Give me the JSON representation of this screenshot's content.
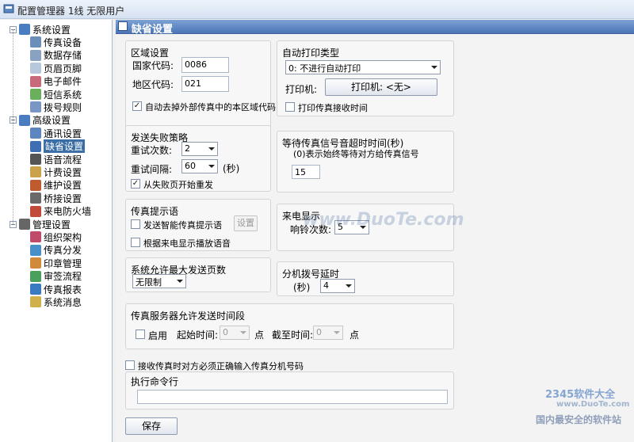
{
  "window": {
    "title": "配置管理器 1线 无限用户"
  },
  "tree": [
    {
      "label": "系统设置",
      "level": 0,
      "color": "#4a7cc0"
    },
    {
      "label": "传真设备",
      "level": 1,
      "color": "#6a8fb8"
    },
    {
      "label": "数据存储",
      "level": 1,
      "color": "#8aa2c2"
    },
    {
      "label": "页眉页脚",
      "level": 1,
      "color": "#b7c7dc"
    },
    {
      "label": "电子邮件",
      "level": 1,
      "color": "#c96a7a"
    },
    {
      "label": "短信系统",
      "level": 1,
      "color": "#6aaf5c"
    },
    {
      "label": "拨号规则",
      "level": 1,
      "color": "#7a96c4"
    },
    {
      "label": "高级设置",
      "level": 0,
      "color": "#4a7cc0"
    },
    {
      "label": "通讯设置",
      "level": 1,
      "color": "#5d86be"
    },
    {
      "label": "缺省设置",
      "level": 1,
      "color": "#3f6fb2",
      "selected": true
    },
    {
      "label": "语音流程",
      "level": 1,
      "color": "#555"
    },
    {
      "label": "计费设置",
      "level": 1,
      "color": "#c9a24a"
    },
    {
      "label": "维护设置",
      "level": 1,
      "color": "#c05a2f"
    },
    {
      "label": "桥接设置",
      "level": 1,
      "color": "#6a6a6a"
    },
    {
      "label": "来电防火墙",
      "level": 1,
      "color": "#c24a3a"
    },
    {
      "label": "管理设置",
      "level": 0,
      "color": "#666"
    },
    {
      "label": "组织架构",
      "level": 1,
      "color": "#c04a6a"
    },
    {
      "label": "传真分发",
      "level": 1,
      "color": "#4a90c8"
    },
    {
      "label": "印章管理",
      "level": 1,
      "color": "#d08a3a"
    },
    {
      "label": "审签流程",
      "level": 1,
      "color": "#4aa05a"
    },
    {
      "label": "传真报表",
      "level": 1,
      "color": "#3a7ac0"
    },
    {
      "label": "系统消息",
      "level": 1,
      "color": "#d0b04a"
    }
  ],
  "header": {
    "title": "缺省设置"
  },
  "region": {
    "title": "区域设置",
    "country_label": "国家代码:",
    "country_value": "0086",
    "area_label": "地区代码:",
    "area_value": "021",
    "strip_label": "自动去掉外部传真中的本区域代码",
    "strip_checked": "✓"
  },
  "autoprint": {
    "title": "自动打印类型",
    "type_value": "0: 不进行自动打印",
    "printer_label": "打印机:",
    "printer_button": "打印机: <无>",
    "print_time_label": "打印传真接收时间",
    "print_time_checked": ""
  },
  "fail": {
    "title": "发送失败策略",
    "retry_count_label": "重试次数:",
    "retry_count_value": "2",
    "retry_interval_label": "重试间隔:",
    "retry_interval_value": "60",
    "retry_interval_unit": "(秒)",
    "resend_label": "从失败页开始重发",
    "resend_checked": "✓"
  },
  "wait": {
    "title": "等待传真信号音超时时间(秒)",
    "hint": "(0)表示始终等待对方给传真信号",
    "value": "15"
  },
  "prompt": {
    "title": "传真提示语",
    "smart_label": "发送智能传真提示语",
    "smart_checked": "",
    "smart_button": "设置",
    "callerid_label": "根据来电显示播放语音",
    "callerid_checked": ""
  },
  "incoming": {
    "title": "来电显示",
    "rings_label": "响铃次数:",
    "rings_value": "5"
  },
  "maxpages": {
    "title": "系统允许最大发送页数",
    "value": "无限制"
  },
  "extdelay": {
    "title": "分机拨号延时",
    "unit": "(秒)",
    "value": "4"
  },
  "window_period": {
    "title": "传真服务器允许发送时间段",
    "enable_label": "启用",
    "enable_checked": "",
    "start_label": "起始时间:",
    "start_value": "0",
    "start_unit": "点",
    "end_label": "截至时间:",
    "end_value": "0",
    "end_unit": "点"
  },
  "require_ext": {
    "label": "接收传真时对方必须正确输入传真分机号码",
    "checked": ""
  },
  "command": {
    "title": "执行命令行",
    "value": ""
  },
  "save_button": "保存",
  "watermark": {
    "center": "www.DuoTe.com",
    "brand": "2345软件大全",
    "url": "www.DuoTe.com",
    "tagline": "国内最安全的软件站"
  }
}
